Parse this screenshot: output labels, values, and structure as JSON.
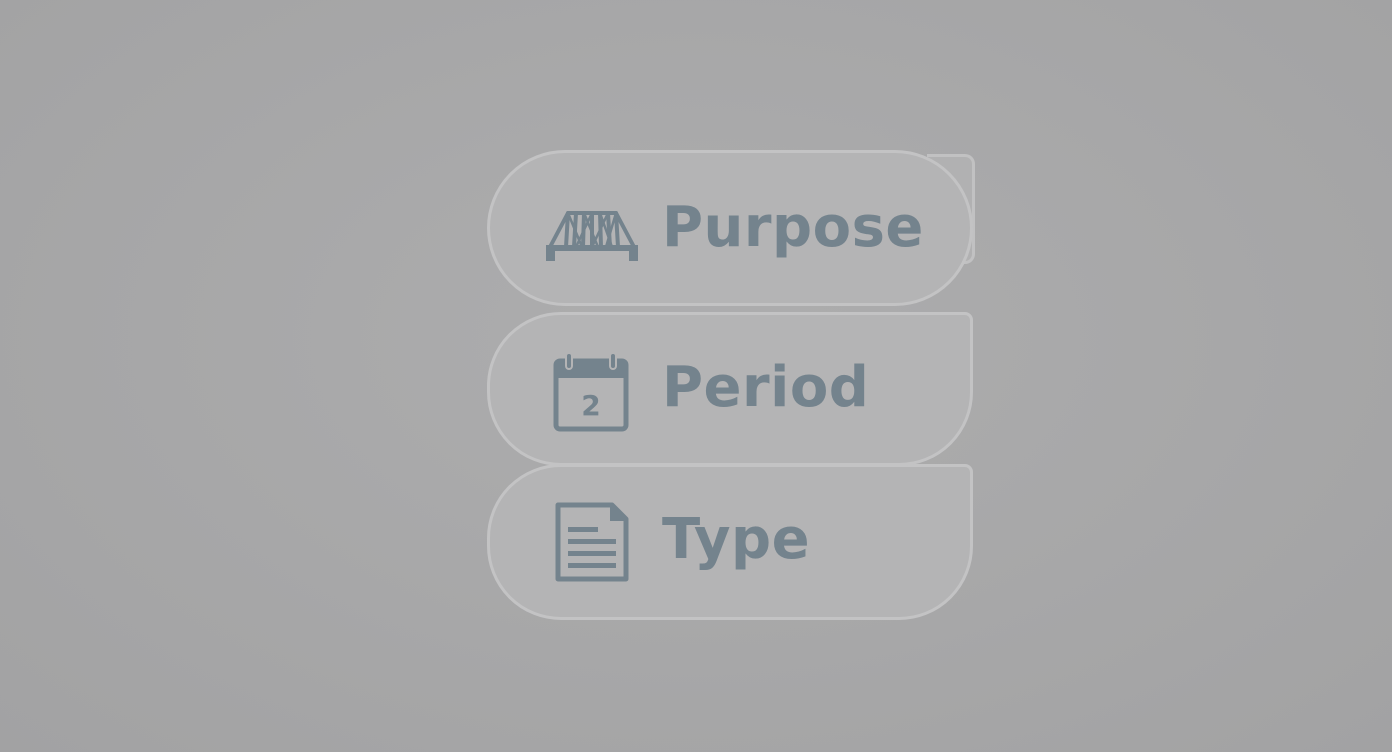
{
  "menu": {
    "items": [
      {
        "label": "Purpose",
        "icon": "bridge-icon"
      },
      {
        "label": "Period",
        "icon": "calendar-icon",
        "calendar_day": "2"
      },
      {
        "label": "Type",
        "icon": "document-icon"
      }
    ]
  },
  "colors": {
    "background": "#a8a8a9",
    "pill_fill": "#b4b4b5",
    "pill_border": "#c3c3c4",
    "accent": "#74838d"
  }
}
